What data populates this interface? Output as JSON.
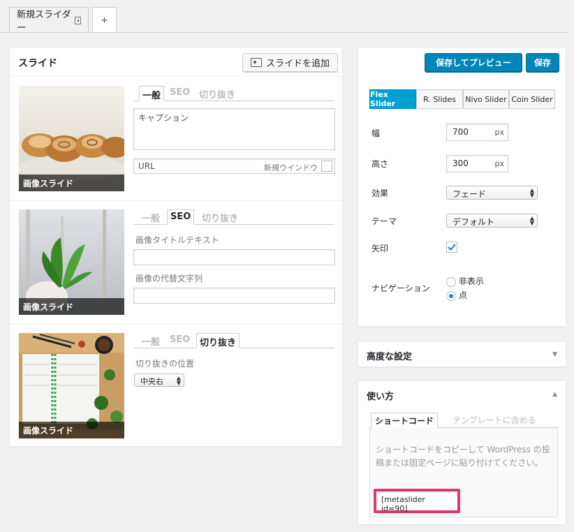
{
  "tabs": {
    "active": "新規スライダー",
    "add": "+"
  },
  "slides": {
    "title": "スライド",
    "add_button": "スライドを追加",
    "items": [
      {
        "caption_badge": "画像スライド",
        "tabs": [
          "一般",
          "SEO",
          "切り抜き"
        ],
        "active_tab": "一般",
        "caption_placeholder": "キャプション",
        "url_placeholder": "URL",
        "new_window_label": "新規ウインドウ"
      },
      {
        "caption_badge": "画像スライド",
        "tabs": [
          "一般",
          "SEO",
          "切り抜き"
        ],
        "active_tab": "SEO",
        "image_title_label": "画像タイトルテキスト",
        "alt_label": "画像の代替文字列"
      },
      {
        "caption_badge": "画像スライド",
        "tabs": [
          "一般",
          "SEO",
          "切り抜き"
        ],
        "active_tab": "切り抜き",
        "crop_label": "切り抜きの位置",
        "crop_value": "中央右"
      }
    ]
  },
  "settings": {
    "preview_button": "保存してプレビュー",
    "save_button": "保存",
    "slider_types": [
      "Flex Slider",
      "R. Slides",
      "Nivo Slider",
      "Coin Slider"
    ],
    "active_slider": "Flex Slider",
    "width_label": "幅",
    "width_value": "700",
    "height_label": "高さ",
    "height_value": "300",
    "unit": "px",
    "effect_label": "効果",
    "effect_value": "フェード",
    "theme_label": "テーマ",
    "theme_value": "デフォルト",
    "arrows_label": "矢印",
    "arrows_checked": true,
    "navigation_label": "ナビゲーション",
    "nav_options": [
      "非表示",
      "点"
    ],
    "nav_selected": "点"
  },
  "advanced": {
    "title": "高度な設定"
  },
  "usage": {
    "title": "使い方",
    "tabs": [
      "ショートコード",
      "テンプレートに含める"
    ],
    "description": "ショートコードをコピーして WordPress の投稿または固定ページに貼り付けてください。",
    "shortcode": "[metaslider id=90]",
    "highlight_color": "#e8336d"
  },
  "colors": {
    "primary": "#0085ba",
    "accent": "#00a0d2"
  }
}
